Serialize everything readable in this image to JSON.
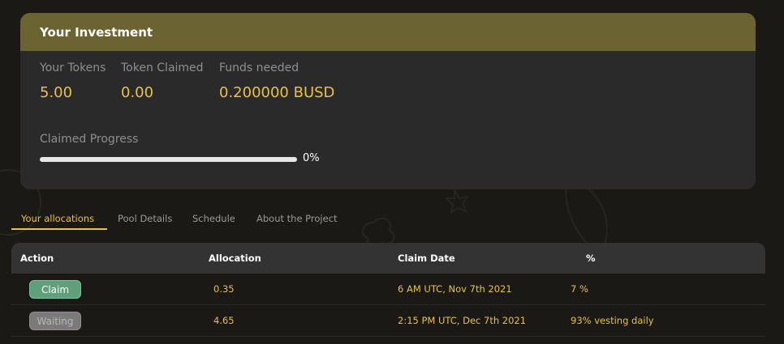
{
  "investment": {
    "title": "Your Investment",
    "stats": [
      {
        "label": "Your Tokens",
        "value": "5.00"
      },
      {
        "label": "Token Claimed",
        "value": "0.00"
      },
      {
        "label": "Funds needed",
        "value": "0.200000 BUSD"
      }
    ],
    "progress": {
      "label": "Claimed Progress",
      "percent_text": "0%",
      "fraction": 0.0
    }
  },
  "tabs": [
    "Your allocations",
    "Pool Details",
    "Schedule",
    "About the Project"
  ],
  "table": {
    "headers": [
      "Action",
      "Allocation",
      "Claim Date",
      "%"
    ],
    "rows": [
      {
        "action": "Claim",
        "allocation": "0.35",
        "date": "6 AM UTC, Nov 7th 2021",
        "percent": "7 %"
      },
      {
        "action": "Waiting",
        "allocation": "4.65",
        "date": "2:15 PM UTC, Dec 7th 2021",
        "percent": "93% vesting daily"
      }
    ]
  },
  "colors": {
    "accent": "#e8c04a",
    "header_band": "#6b6432",
    "claim": "#5fa07a",
    "waiting": "#7a7a7a"
  }
}
